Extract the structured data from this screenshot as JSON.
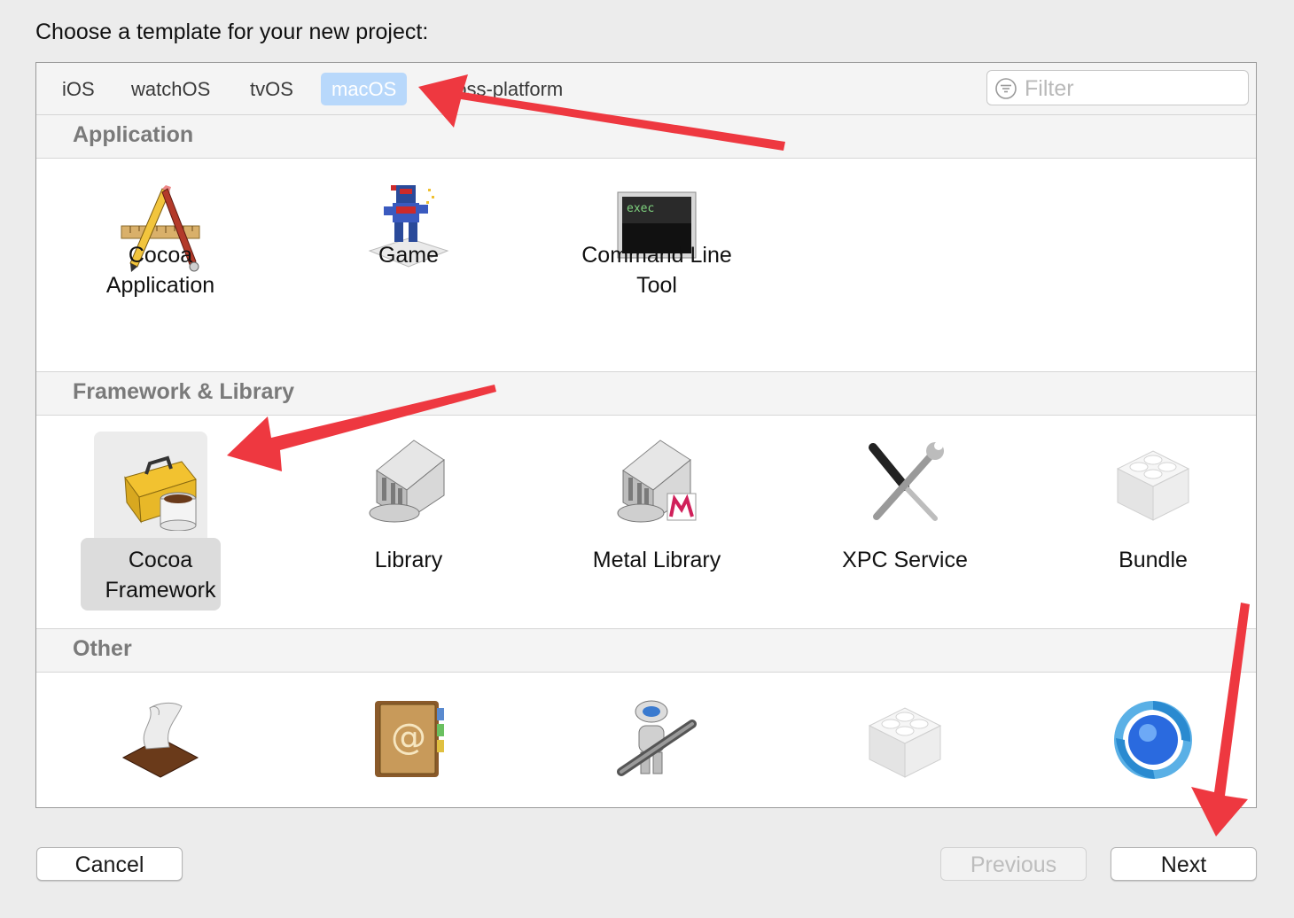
{
  "dialog": {
    "title": "Choose a template for your new project:"
  },
  "tabs": [
    {
      "label": "iOS",
      "selected": false
    },
    {
      "label": "watchOS",
      "selected": false
    },
    {
      "label": "tvOS",
      "selected": false
    },
    {
      "label": "macOS",
      "selected": true
    },
    {
      "label": "Cross-platform",
      "selected": false
    }
  ],
  "filter": {
    "placeholder": "Filter",
    "icon": "filter-icon"
  },
  "sections": [
    {
      "title": "Application",
      "items": [
        {
          "label": "Cocoa\nApplication",
          "icon": "cocoa-app-icon"
        },
        {
          "label": "Game",
          "icon": "game-icon"
        },
        {
          "label": "Command Line\nTool",
          "icon": "terminal-icon",
          "icon_text": "exec"
        }
      ]
    },
    {
      "title": "Framework & Library",
      "items": [
        {
          "label": "Cocoa\nFramework",
          "icon": "toolbox-icon",
          "selected": true
        },
        {
          "label": "Library",
          "icon": "library-building-icon"
        },
        {
          "label": "Metal Library",
          "icon": "metal-library-icon"
        },
        {
          "label": "XPC Service",
          "icon": "tools-icon"
        },
        {
          "label": "Bundle",
          "icon": "lego-brick-icon"
        }
      ]
    },
    {
      "title": "Other",
      "items": [
        {
          "icon": "applescript-icon"
        },
        {
          "icon": "address-book-icon"
        },
        {
          "icon": "automator-robot-icon"
        },
        {
          "icon": "lego-brick-icon"
        },
        {
          "icon": "quartz-composer-icon"
        }
      ]
    }
  ],
  "buttons": {
    "cancel": "Cancel",
    "previous": "Previous",
    "next": "Next"
  },
  "annotation_color": "#ee3840"
}
